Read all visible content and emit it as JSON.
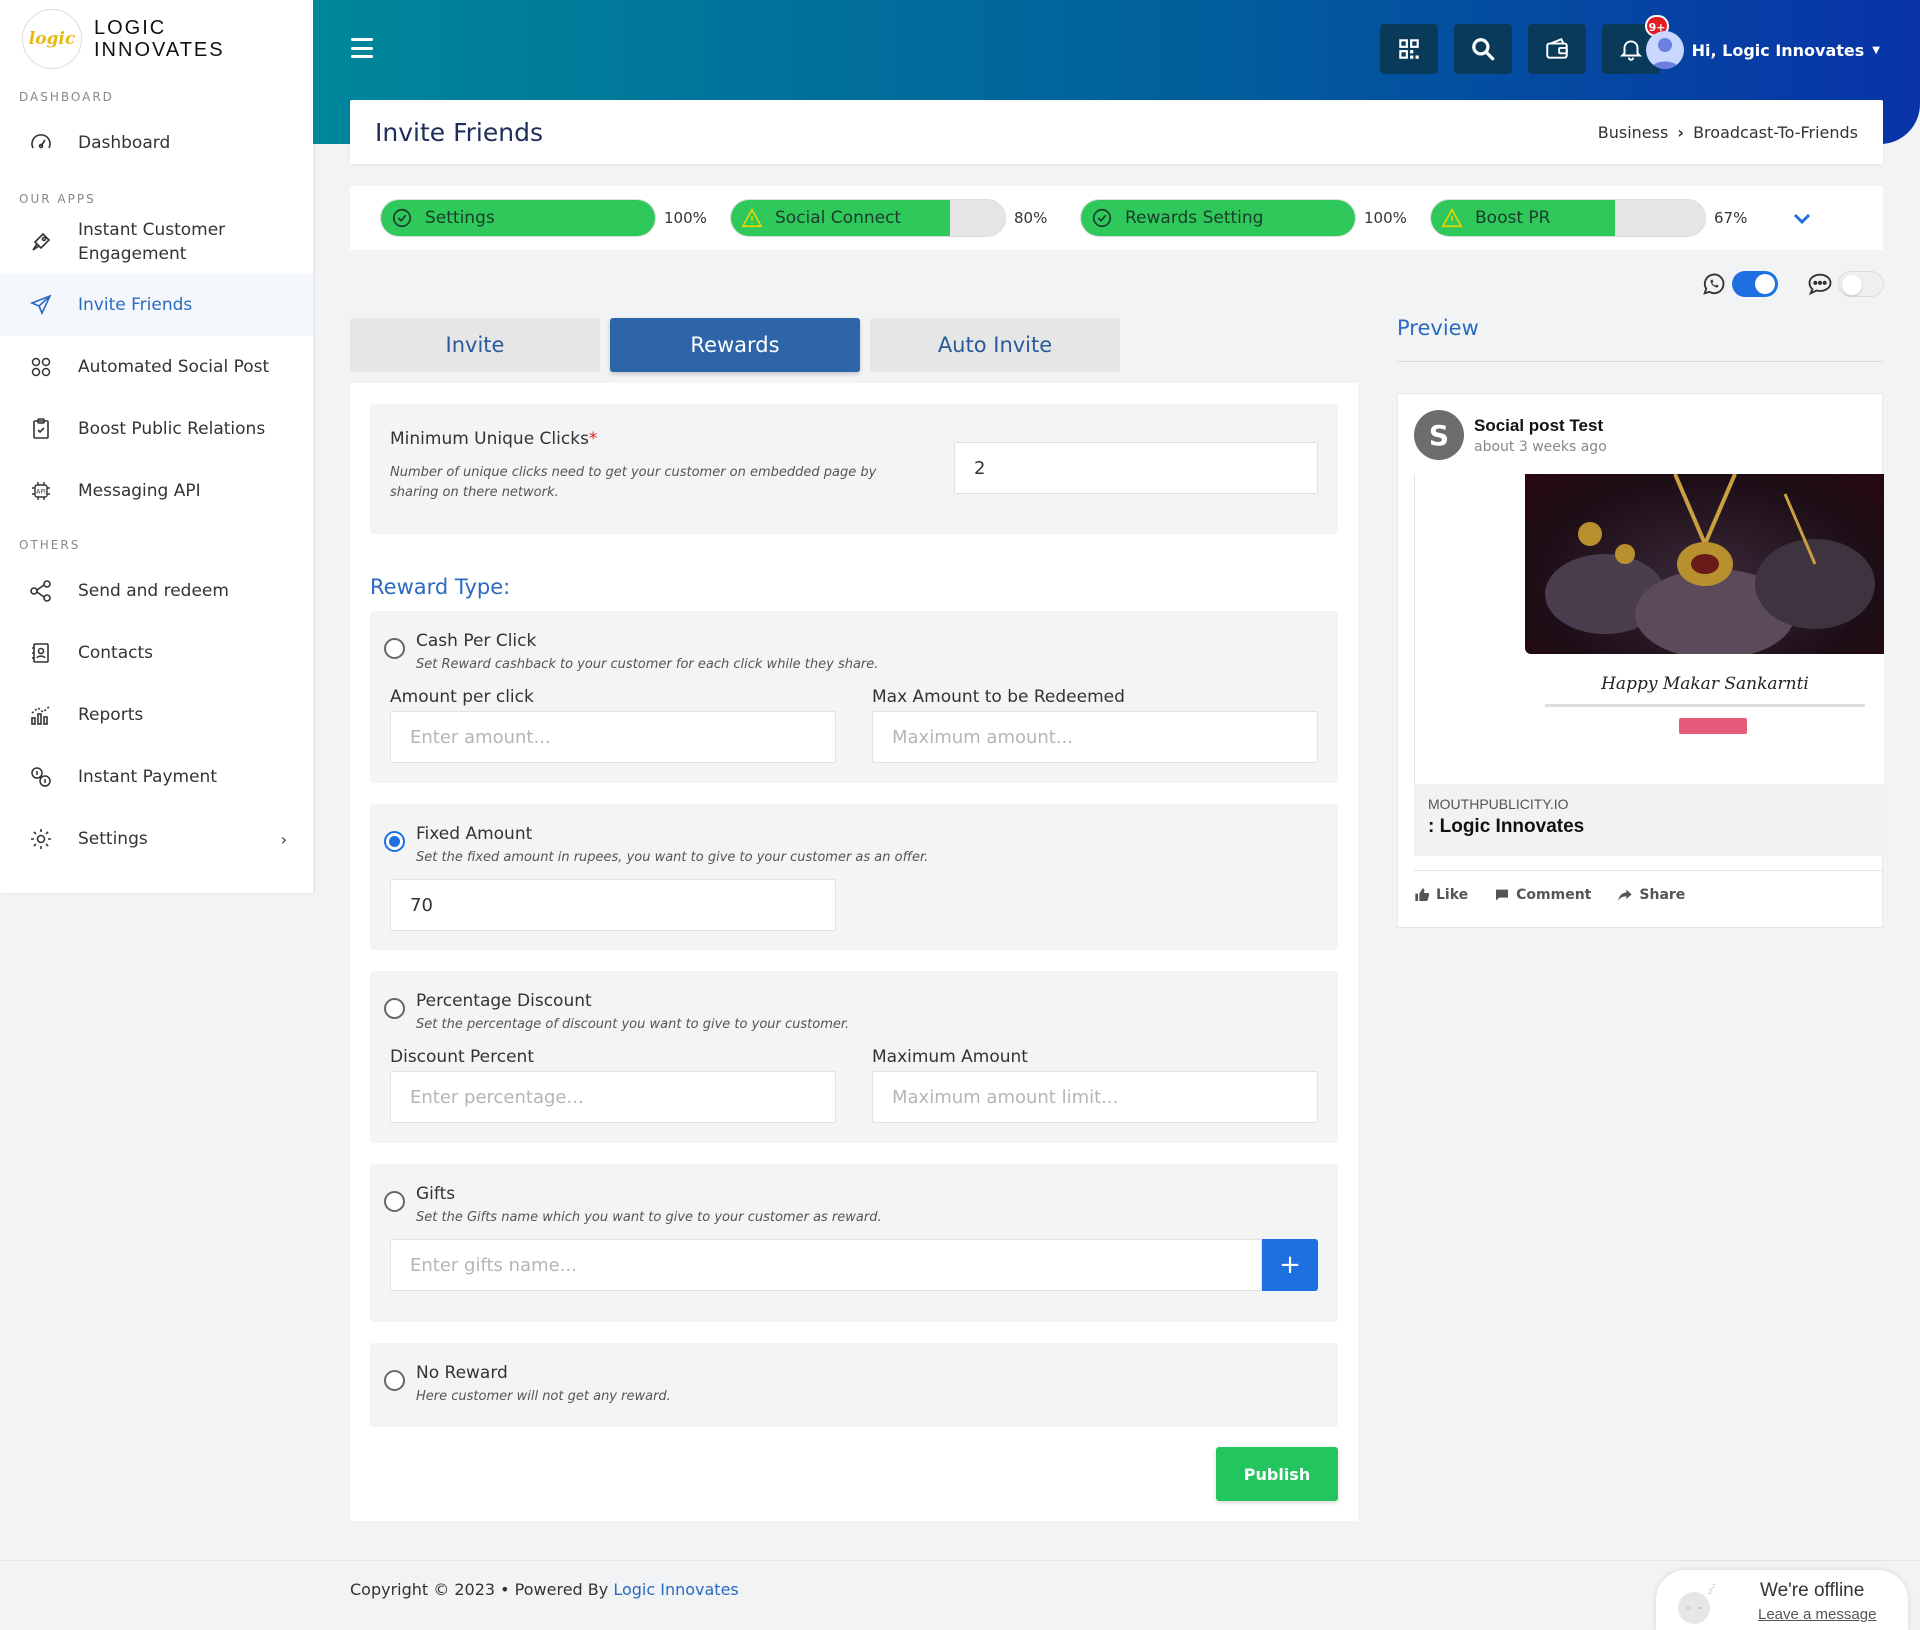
{
  "brand": {
    "logo_text": "logic",
    "name_line1": "LOGIC",
    "name_line2": "INNOVATES"
  },
  "sidebar": {
    "section_dashboard": "DASHBOARD",
    "section_apps": "OUR APPS",
    "section_others": "OTHERS",
    "items": [
      {
        "label": "Dashboard",
        "icon": "speedometer-icon"
      },
      {
        "label": "Instant Customer Engagement",
        "icon": "rocket-icon"
      },
      {
        "label": "Invite Friends",
        "icon": "paper-plane-icon",
        "active": true
      },
      {
        "label": "Automated Social Post",
        "icon": "social-icon"
      },
      {
        "label": "Boost Public Relations",
        "icon": "clipboard-icon"
      },
      {
        "label": "Messaging API",
        "icon": "api-icon"
      },
      {
        "label": "Send and redeem",
        "icon": "share-nodes-icon"
      },
      {
        "label": "Contacts",
        "icon": "contact-book-icon"
      },
      {
        "label": "Reports",
        "icon": "bar-chart-icon"
      },
      {
        "label": "Instant Payment",
        "icon": "payment-icon"
      },
      {
        "label": "Settings",
        "icon": "gear-icon"
      }
    ]
  },
  "header": {
    "notification_count": "9+",
    "user_greeting": "Hi, Logic Innovates"
  },
  "page": {
    "title": "Invite Friends",
    "breadcrumb_parent": "Business",
    "breadcrumb_sep": "›",
    "breadcrumb_current": "Broadcast-To-Friends"
  },
  "progress": [
    {
      "label": "Settings",
      "percent": 100,
      "percent_text": "100%",
      "status": "complete"
    },
    {
      "label": "Social Connect",
      "percent": 80,
      "percent_text": "80%",
      "status": "warning"
    },
    {
      "label": "Rewards Setting",
      "percent": 100,
      "percent_text": "100%",
      "status": "complete"
    },
    {
      "label": "Boost PR",
      "percent": 67,
      "percent_text": "67%",
      "status": "warning"
    }
  ],
  "toggles": {
    "whatsapp_on": true,
    "sms_on": false
  },
  "tabs": [
    {
      "label": "Invite",
      "active": false
    },
    {
      "label": "Rewards",
      "active": true
    },
    {
      "label": "Auto Invite",
      "active": false
    }
  ],
  "form": {
    "min_clicks_label": "Minimum Unique Clicks",
    "required_mark": "*",
    "min_clicks_hint": "Number of unique clicks need to get your customer on embedded page by sharing on there network.",
    "min_clicks_value": "2",
    "reward_type_label": "Reward Type:",
    "cash": {
      "title": "Cash Per Click",
      "hint": "Set Reward cashback to your customer for each click while they share.",
      "amount_label": "Amount per click",
      "amount_placeholder": "Enter amount...",
      "max_label": "Max Amount to be Redeemed",
      "max_placeholder": "Maximum amount..."
    },
    "fixed": {
      "title": "Fixed Amount",
      "hint": "Set the fixed amount in rupees, you want to give to your customer as an offer.",
      "value": "70"
    },
    "percent": {
      "title": "Percentage Discount",
      "hint": "Set the percentage of discount you want to give to your customer.",
      "discount_label": "Discount Percent",
      "discount_placeholder": "Enter percentage...",
      "max_label": "Maximum Amount",
      "max_placeholder": "Maximum amount limit..."
    },
    "gifts": {
      "title": "Gifts",
      "hint": "Set the Gifts name which you want to give to your customer as reward.",
      "placeholder": "Enter gifts name...",
      "add_label": "+"
    },
    "none": {
      "title": "No Reward",
      "hint": "Here customer will not get any reward."
    },
    "selected": "fixed",
    "publish_label": "Publish"
  },
  "preview": {
    "title": "Preview",
    "avatar_letter": "S",
    "post_name": "Social post Test",
    "post_time": "about 3 weeks ago",
    "image_caption": "Happy Makar Sankarnti",
    "link_domain": "MOUTHPUBLICITY.IO",
    "link_title": ": Logic Innovates",
    "like": "Like",
    "comment": "Comment",
    "share": "Share"
  },
  "footer": {
    "copyright": "Copyright © 2023  • Powered By",
    "company": "Logic Innovates"
  },
  "chat": {
    "status": "We're offline",
    "action": "Leave a message"
  },
  "colors": {
    "accent": "#2a6ac0",
    "success": "#2ec95a",
    "primary": "#1e6fe0"
  }
}
